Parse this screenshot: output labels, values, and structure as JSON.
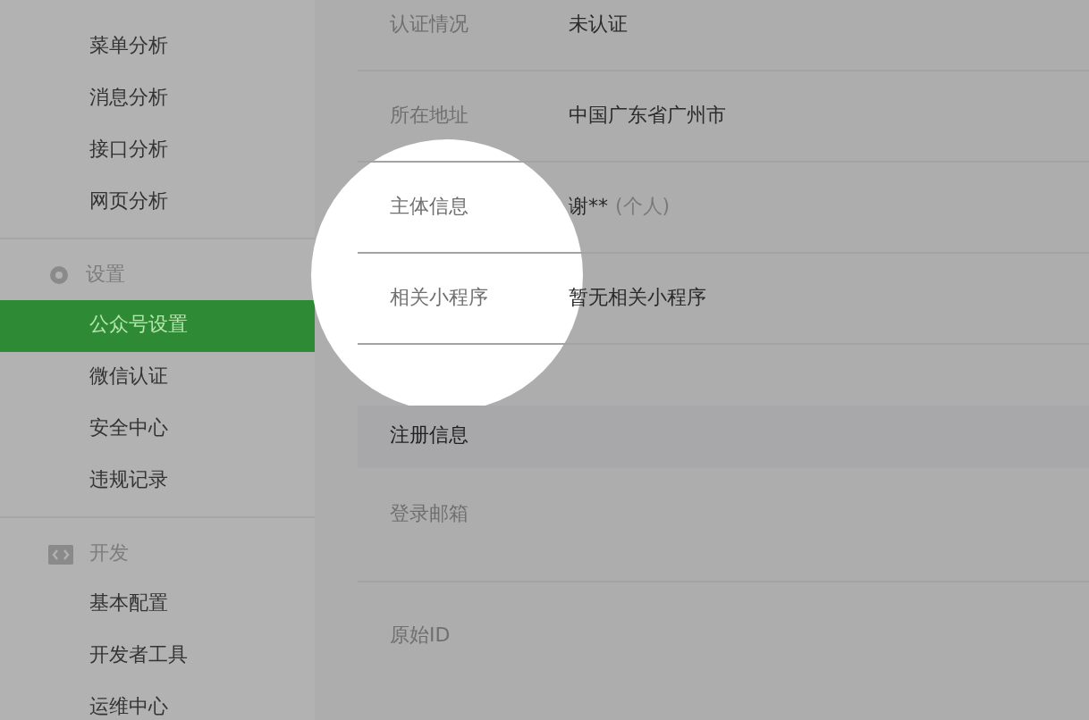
{
  "sidebar": {
    "sections": [
      {
        "kind": "plain",
        "items": [
          {
            "label": "菜单分析",
            "selected": false
          },
          {
            "label": "消息分析",
            "selected": false
          },
          {
            "label": "接口分析",
            "selected": false
          },
          {
            "label": "网页分析",
            "selected": false
          }
        ]
      },
      {
        "kind": "settings",
        "heading": "设置",
        "items": [
          {
            "label": "公众号设置",
            "selected": true
          },
          {
            "label": "微信认证",
            "selected": false
          },
          {
            "label": "安全中心",
            "selected": false
          },
          {
            "label": "违规记录",
            "selected": false
          }
        ]
      },
      {
        "kind": "develop",
        "heading": "开发",
        "items": [
          {
            "label": "基本配置",
            "selected": false
          },
          {
            "label": "开发者工具",
            "selected": false
          },
          {
            "label": "运维中心",
            "selected": false
          }
        ]
      }
    ]
  },
  "account_info": {
    "rows": [
      {
        "label": "认证情况",
        "value": "未认证"
      },
      {
        "label": "所在地址",
        "value": "中国广东省广州市"
      },
      {
        "label": "主体信息",
        "value": "谢**",
        "note": "(个人)"
      },
      {
        "label": "相关小程序",
        "value": "暂无相关小程序"
      }
    ]
  },
  "registration": {
    "heading": "注册信息",
    "rows": [
      {
        "label": "登录邮箱"
      },
      {
        "label": "原始ID"
      }
    ]
  }
}
